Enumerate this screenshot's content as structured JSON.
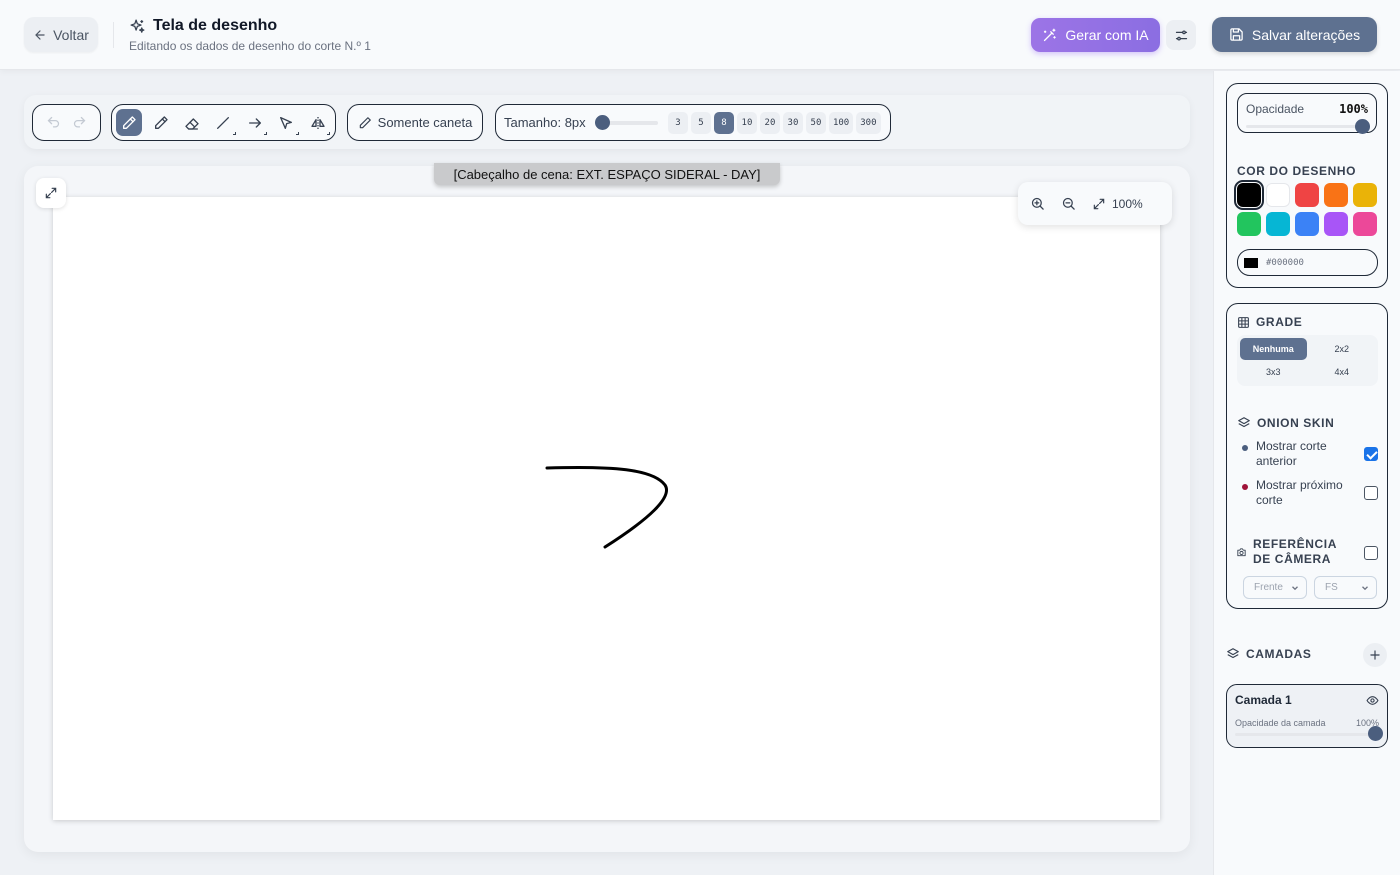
{
  "header": {
    "back_label": "Voltar",
    "title": "Tela de desenho",
    "subtitle": "Editando os dados de desenho do corte N.º 1",
    "ai_label": "Gerar com IA",
    "save_label": "Salvar alterações"
  },
  "toolbar": {
    "tools": [
      "brush-icon",
      "pencil-icon",
      "eraser-icon",
      "line-icon",
      "arrow-icon",
      "select-icon",
      "mirror-icon"
    ],
    "active_tool": "brush-icon",
    "pen_only_label": "Somente caneta",
    "size_label": "Tamanho: 8px",
    "size_value": 8,
    "sizes": [
      "3",
      "5",
      "8",
      "10",
      "20",
      "30",
      "50",
      "100",
      "300"
    ],
    "active_size": "8"
  },
  "canvas": {
    "scene_header": "[Cabeçalho de cena: EXT. ESPAÇO SIDERAL - DAY]",
    "zoom_label": "100%",
    "stroke_color": "#000000"
  },
  "sidebar": {
    "opacity_label": "Opacidade",
    "opacity_value": "100%",
    "color_title": "COR DO DESENHO",
    "colors": [
      "#000000",
      "#ffffff",
      "#ef4444",
      "#f97316",
      "#eab308",
      "#22c55e",
      "#06b6d4",
      "#3b82f6",
      "#a855f7",
      "#ec4899"
    ],
    "selected_color": "#000000",
    "hex_value": "#000000",
    "grid_title": "GRADE",
    "grid_options": [
      "Nenhuma",
      "2x2",
      "3x3",
      "4x4"
    ],
    "grid_selected": "Nenhuma",
    "onion_title": "ONION SKIN",
    "onion_prev_label": "Mostrar corte anterior",
    "onion_prev_checked": true,
    "onion_prev_color": "#4b5e7e",
    "onion_next_label": "Mostrar próximo corte",
    "onion_next_checked": false,
    "onion_next_color": "#9f1239",
    "camera_title": "REFERÊNCIA DE CÂMERA",
    "camera_checked": false,
    "camera_angle": "Frente",
    "camera_shot": "FS",
    "layers_title": "CAMADAS",
    "layer_name": "Camada 1",
    "layer_opacity_label": "Opacidade da camada",
    "layer_opacity_value": "100%"
  },
  "colors": {
    "accent": "#5e7190",
    "ai_purple": "#9c74e6",
    "checkbox_blue": "#1a73e8"
  }
}
